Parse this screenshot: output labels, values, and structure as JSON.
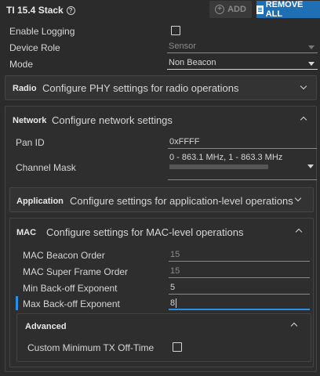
{
  "header": {
    "title": "TI 15.4 Stack",
    "add_label": "ADD",
    "remove_all_label": "REMOVE ALL"
  },
  "top": {
    "enable_logging_label": "Enable Logging",
    "device_role_label": "Device Role",
    "device_role_value": "Sensor",
    "mode_label": "Mode",
    "mode_value": "Non Beacon"
  },
  "radio": {
    "title": "Radio",
    "desc": "Configure PHY settings for radio operations"
  },
  "network": {
    "title": "Network",
    "desc": "Configure network settings",
    "pan_id_label": "Pan ID",
    "pan_id_value": "0xFFFF",
    "channel_mask_label": "Channel Mask",
    "channel_mask_value": "0 - 863.1 MHz, 1 - 863.3 MHz"
  },
  "application": {
    "title": "Application",
    "desc": "Configure settings for application-level operations"
  },
  "mac": {
    "title": "MAC",
    "desc": "Configure settings for MAC-level operations",
    "beacon_order_label": "MAC Beacon Order",
    "beacon_order_value": "15",
    "super_frame_label": "MAC Super Frame Order",
    "super_frame_value": "15",
    "min_backoff_label": "Min Back-off Exponent",
    "min_backoff_value": "5",
    "max_backoff_label": "Max Back-off Exponent",
    "max_backoff_value": "8"
  },
  "advanced": {
    "title": "Advanced",
    "custom_tx_label": "Custom Minimum TX Off-Time"
  }
}
